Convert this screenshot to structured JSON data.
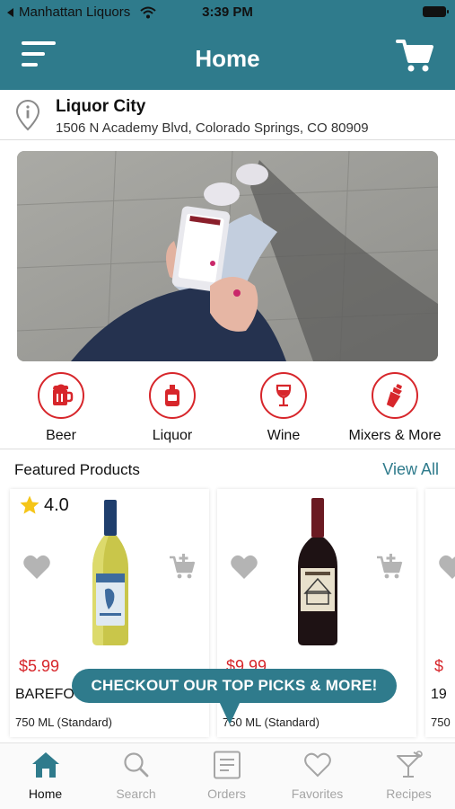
{
  "status_bar": {
    "back_app": "Manhattan Liquors",
    "time": "3:39 PM"
  },
  "header": {
    "title": "Home",
    "menu_icon": "hamburger-menu-icon",
    "cart_icon": "shopping-cart-icon"
  },
  "location": {
    "store_name": "Liquor City",
    "address": "1506 N Academy Blvd, Colorado Springs, CO 80909",
    "icon": "location-info-icon"
  },
  "categories": [
    {
      "label": "Beer",
      "icon": "beer-mug-icon"
    },
    {
      "label": "Liquor",
      "icon": "liquor-bottle-icon"
    },
    {
      "label": "Wine",
      "icon": "wine-glass-icon"
    },
    {
      "label": "Mixers & More",
      "icon": "cocktail-shaker-icon"
    }
  ],
  "featured": {
    "title": "Featured Products",
    "view_all": "View All",
    "products": [
      {
        "rating": "4.0",
        "price": "$5.99",
        "name": "BAREFOO",
        "size": "750 ML (Standard)"
      },
      {
        "rating": "",
        "price": "$9.99",
        "name": "",
        "size": "750 ML (Standard)"
      },
      {
        "rating": "",
        "price": "$",
        "name": "19",
        "size": "750"
      }
    ]
  },
  "tooltip": {
    "text": "CHECKOUT OUR TOP PICKS & MORE!"
  },
  "tabbar": {
    "active": "Home",
    "tabs": [
      {
        "label": "Home",
        "icon": "home-icon"
      },
      {
        "label": "Search",
        "icon": "search-icon"
      },
      {
        "label": "Orders",
        "icon": "orders-icon"
      },
      {
        "label": "Favorites",
        "icon": "heart-icon"
      },
      {
        "label": "Recipes",
        "icon": "cocktail-glass-icon"
      }
    ]
  },
  "colors": {
    "brand_teal": "#2f7b8c",
    "accent_red": "#d7262b",
    "inactive_gray": "#a5a5a5"
  }
}
